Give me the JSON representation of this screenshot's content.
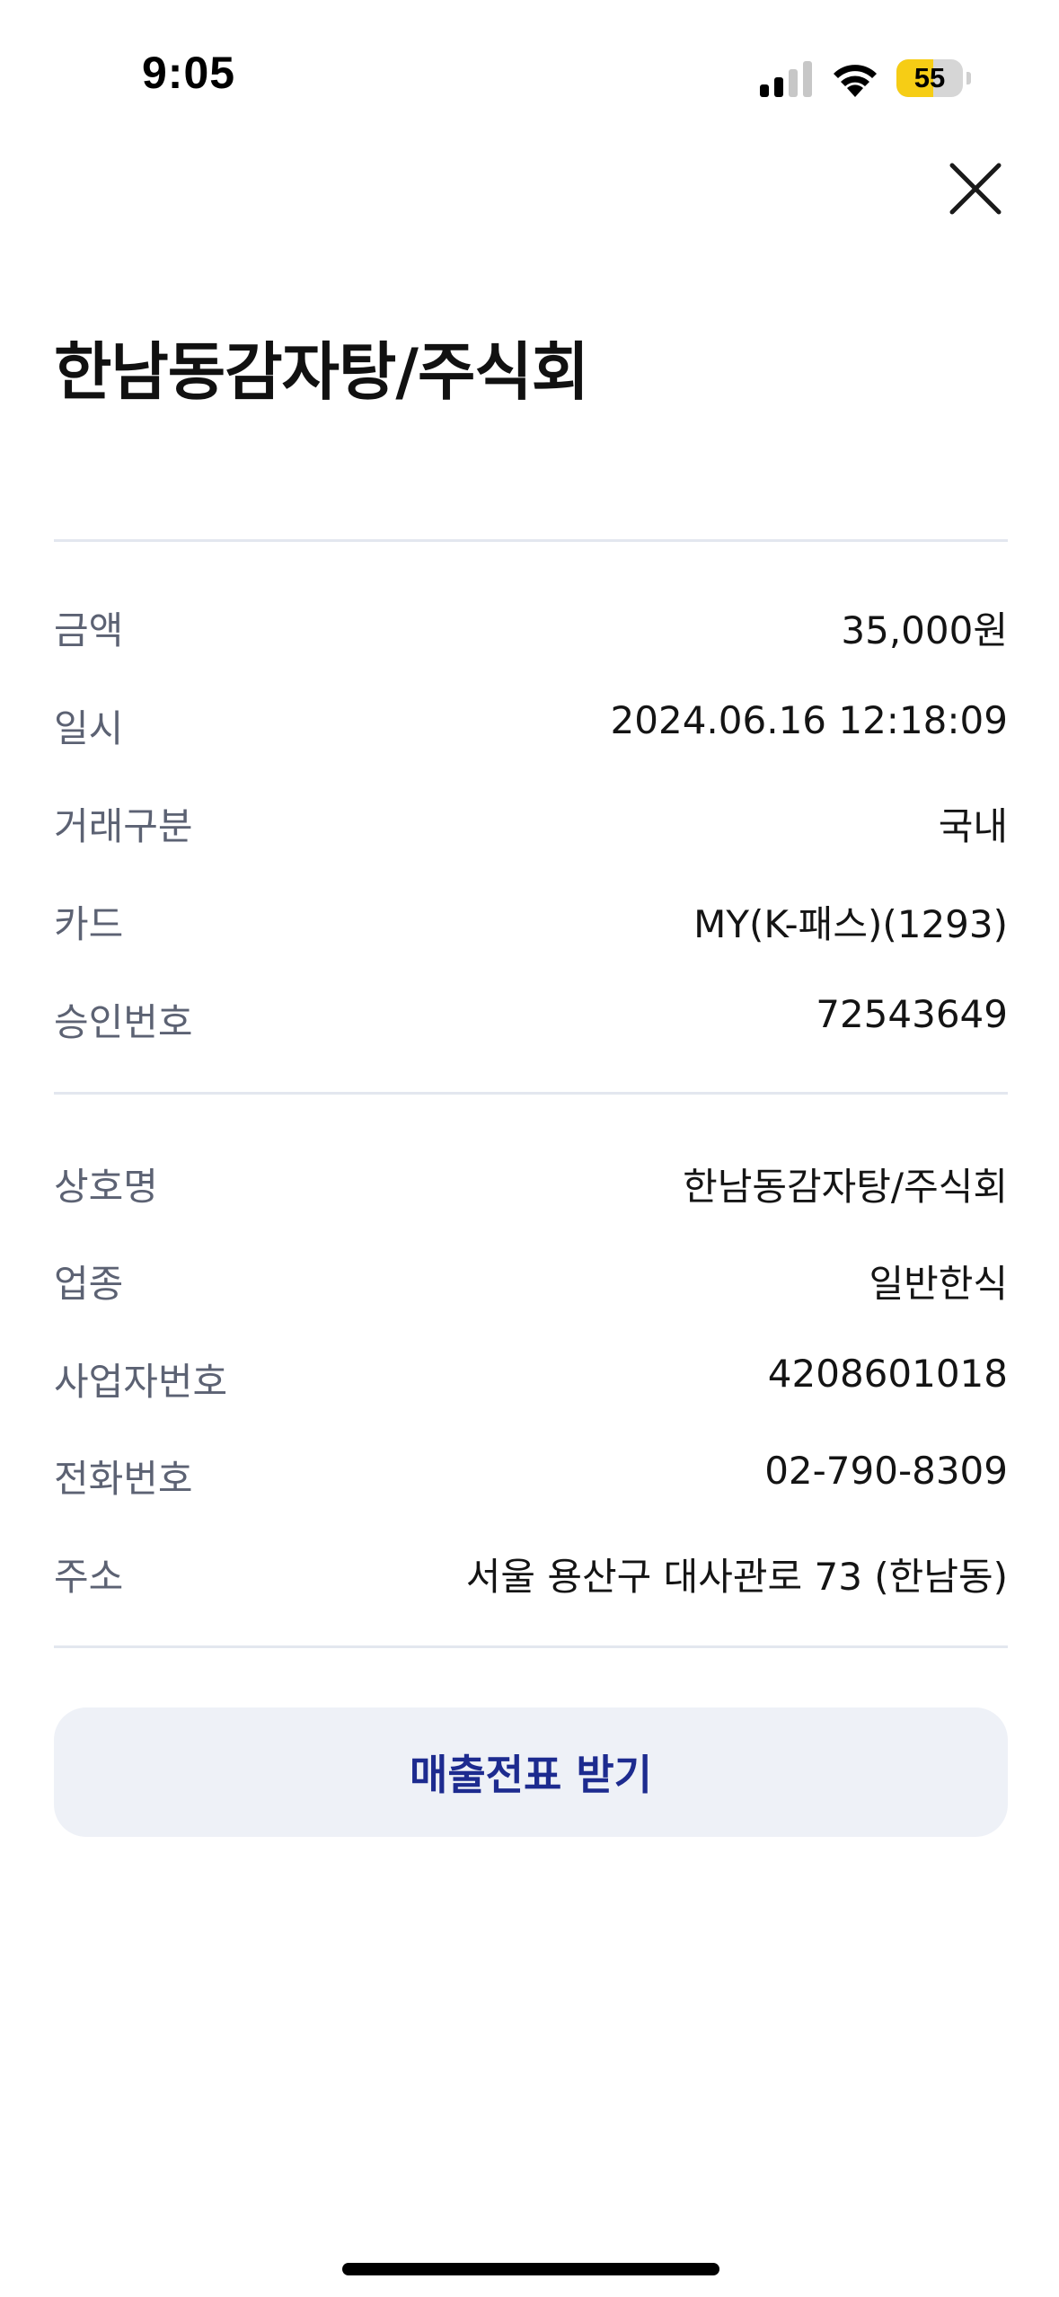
{
  "status_bar": {
    "time": "9:05",
    "battery_level": "55",
    "battery_fraction": 0.55,
    "battery_color": "#f6cd15",
    "icons": [
      "signal-icon",
      "wifi-icon",
      "battery-icon"
    ]
  },
  "header": {
    "close_icon": "close-icon",
    "title": "한남동감자탕/주식회"
  },
  "transaction": {
    "rows": [
      {
        "label": "금액",
        "value": "35,000원"
      },
      {
        "label": "일시",
        "value": "2024.06.16 12:18:09"
      },
      {
        "label": "거래구분",
        "value": "국내"
      },
      {
        "label": "카드",
        "value": "MY(K-패스)(1293)"
      },
      {
        "label": "승인번호",
        "value": "72543649"
      }
    ]
  },
  "merchant": {
    "rows": [
      {
        "label": "상호명",
        "value": "한남동감자탕/주식회"
      },
      {
        "label": "업종",
        "value": "일반한식"
      },
      {
        "label": "사업자번호",
        "value": "4208601018"
      },
      {
        "label": "전화번호",
        "value": "02-790-8309"
      },
      {
        "label": "주소",
        "value": "서울 용산구 대사관로 73 (한남동)"
      }
    ]
  },
  "actions": {
    "receipt_button_label": "매출전표 받기",
    "receipt_button_color": "#1d2b8f"
  }
}
